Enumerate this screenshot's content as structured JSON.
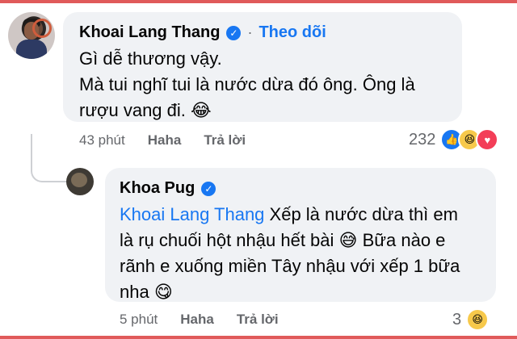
{
  "comment1": {
    "author": "Khoai Lang Thang",
    "follow_label": "Theo dõi",
    "line1": "Gì dễ thương vậy.",
    "line2": "Mà tui nghĩ tui là nước dừa đó ông. Ông là",
    "line3": "rượu vang đi.",
    "emoji_end": "😂",
    "time": "43 phút",
    "react_action": "Haha",
    "reply_action": "Trả lời",
    "reaction_count": "232",
    "reactions": [
      "like-icon",
      "haha-icon",
      "love-icon"
    ]
  },
  "comment2": {
    "author": "Khoa Pug",
    "mention": "Khoai Lang Thang",
    "line1_rest": " Xếp là nước dừa thì em",
    "line2": "là rụ chuối hột nhậu hết bài",
    "emoji_mid": "😅",
    "line2_tail": " Bữa nào e",
    "line3": "rãnh e xuống miền Tây nhậu với xếp 1 bữa",
    "line4": "nha",
    "emoji_end": "😋",
    "time": "5 phút",
    "react_action": "Haha",
    "reply_action": "Trả lời",
    "reaction_count": "3",
    "reactions": [
      "haha-icon"
    ]
  }
}
